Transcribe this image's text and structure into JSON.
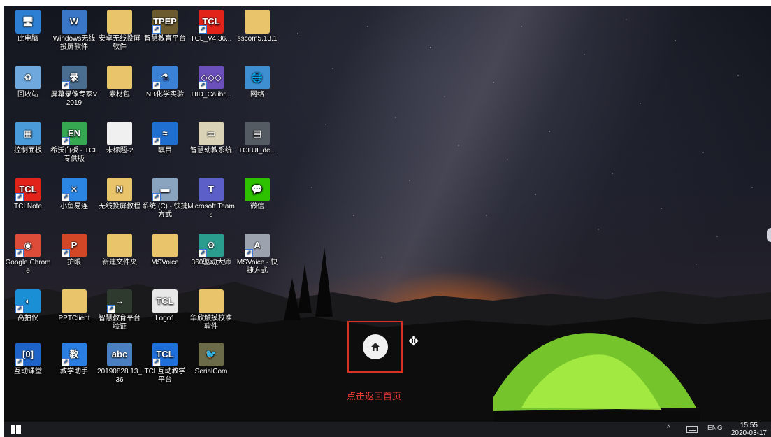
{
  "desktop": {
    "icons": [
      {
        "label": "此电脑",
        "glyph": "🖥",
        "color": "#2d7fd3",
        "shortcut": false
      },
      {
        "label": "Windows无线投屏软件",
        "glyph": "W",
        "color": "#3a77c9",
        "shortcut": false
      },
      {
        "label": "安卓无线投屏软件",
        "glyph": "",
        "color": "#e9c46a",
        "shortcut": false
      },
      {
        "label": "智慧教育平台",
        "glyph": "TPEP",
        "color": "#6b5a2d",
        "shortcut": true
      },
      {
        "label": "TCL_V4.36...",
        "glyph": "TCL",
        "color": "#e2231a",
        "shortcut": true
      },
      {
        "label": "sscom5.13.1",
        "glyph": "",
        "color": "#e9c46a",
        "shortcut": false
      },
      {
        "label": "回收站",
        "glyph": "♻",
        "color": "#6fa8dc",
        "shortcut": false
      },
      {
        "label": "屏幕录像专家V2019",
        "glyph": "录",
        "color": "#4a6e8f",
        "shortcut": true
      },
      {
        "label": "素材包",
        "glyph": "",
        "color": "#e9c46a",
        "shortcut": false
      },
      {
        "label": "NB化学实验",
        "glyph": "⚗",
        "color": "#3b82d6",
        "shortcut": true
      },
      {
        "label": "HID_Calibr...",
        "glyph": "◇◇◇",
        "color": "#6b4fbb",
        "shortcut": true
      },
      {
        "label": "网络",
        "glyph": "🌐",
        "color": "#3d8fd1",
        "shortcut": false
      },
      {
        "label": "控制面板",
        "glyph": "▦",
        "color": "#4a9bd9",
        "shortcut": false
      },
      {
        "label": "希沃白板 - TCL专供版",
        "glyph": "EN",
        "color": "#36a852",
        "shortcut": true
      },
      {
        "label": "未标题-2",
        "glyph": "",
        "color": "#f0f0f0",
        "shortcut": false
      },
      {
        "label": "瞩目",
        "glyph": "≈",
        "color": "#1f6fd0",
        "shortcut": true
      },
      {
        "label": "智慧幼教系统",
        "glyph": "▭",
        "color": "#d9d2b6",
        "shortcut": false
      },
      {
        "label": "TCLUI_de...",
        "glyph": "▤",
        "color": "#555b63",
        "shortcut": false
      },
      {
        "label": "TCLNote",
        "glyph": "TCL",
        "color": "#e2231a",
        "shortcut": true
      },
      {
        "label": "小鱼易连",
        "glyph": "✕",
        "color": "#2b86e3",
        "shortcut": true
      },
      {
        "label": "无线投屏教程",
        "glyph": "N",
        "color": "#e9c46a",
        "shortcut": false
      },
      {
        "label": "系统 (C) - 快捷方式",
        "glyph": "▬",
        "color": "#8aa4c0",
        "shortcut": true
      },
      {
        "label": "Microsoft Teams",
        "glyph": "T",
        "color": "#5b5fc7",
        "shortcut": false
      },
      {
        "label": "微信",
        "glyph": "💬",
        "color": "#2dc100",
        "shortcut": false
      },
      {
        "label": "Google Chrome",
        "glyph": "◉",
        "color": "#dd4b39",
        "shortcut": true
      },
      {
        "label": "护眼",
        "glyph": "P",
        "color": "#d24726",
        "shortcut": true
      },
      {
        "label": "新建文件夹",
        "glyph": "",
        "color": "#e9c46a",
        "shortcut": false
      },
      {
        "label": "MSVoice",
        "glyph": "",
        "color": "#e9c46a",
        "shortcut": false
      },
      {
        "label": "360驱动大师",
        "glyph": "⚙",
        "color": "#2a9d8f",
        "shortcut": true
      },
      {
        "label": "MSVoice - 快捷方式",
        "glyph": "A",
        "color": "#9ca3af",
        "shortcut": true
      },
      {
        "label": "高拍仪",
        "glyph": "◐",
        "color": "#1b8fd6",
        "shortcut": true
      },
      {
        "label": "PPTClient",
        "glyph": "",
        "color": "#e9c46a",
        "shortcut": false
      },
      {
        "label": "智慧教育平台验证",
        "glyph": "→",
        "color": "#2f3a2f",
        "shortcut": true
      },
      {
        "label": "Logo1",
        "glyph": "TCL",
        "color": "#e8e8e8",
        "shortcut": false
      },
      {
        "label": "华欣触摸校准软件",
        "glyph": "",
        "color": "#e9c46a",
        "shortcut": false
      },
      {
        "label": "",
        "glyph": "",
        "color": "transparent",
        "shortcut": false
      },
      {
        "label": "互动课堂",
        "glyph": "[0]",
        "color": "#1e64c8",
        "shortcut": true
      },
      {
        "label": "教学助手",
        "glyph": "教",
        "color": "#2a7de1",
        "shortcut": true
      },
      {
        "label": "20190828 13_36",
        "glyph": "abc",
        "color": "#4a7fc1",
        "shortcut": false
      },
      {
        "label": "TCL互动教学平台",
        "glyph": "TCL",
        "color": "#1e6fd9",
        "shortcut": true
      },
      {
        "label": "SerialCom",
        "glyph": "🐦",
        "color": "#6b6b4a",
        "shortcut": false
      },
      {
        "label": "",
        "glyph": "",
        "color": "transparent",
        "shortcut": false
      }
    ]
  },
  "home_overlay": {
    "caption": "点击返回首页",
    "home_icon": "home-icon",
    "move_icon": "move-arrows-icon",
    "highlight_color": "#d93025"
  },
  "taskbar": {
    "start_icon": "windows-start-icon",
    "tray_chevron": "^",
    "keyboard_icon": "keyboard-icon",
    "language": "ENG",
    "time": "15:55",
    "date": "2020-03-17"
  }
}
